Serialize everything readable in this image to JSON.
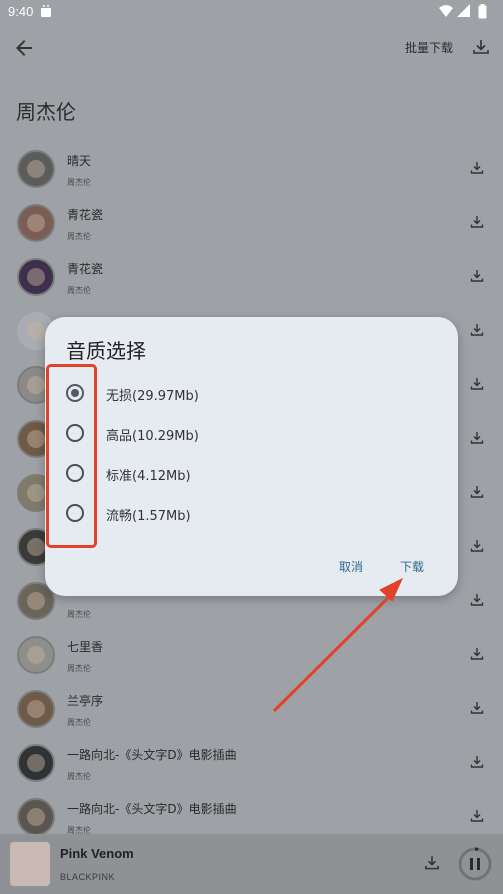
{
  "status_bar": {
    "time": "9:40"
  },
  "app_bar": {
    "batch_download_label": "批量下载"
  },
  "artist_title": "周杰伦",
  "songs": [
    {
      "title": "晴天",
      "artist": "周杰伦"
    },
    {
      "title": "青花瓷",
      "artist": "周杰伦"
    },
    {
      "title": "青花瓷",
      "artist": "周杰伦"
    },
    {
      "title": "",
      "artist": ""
    },
    {
      "title": "",
      "artist": ""
    },
    {
      "title": "",
      "artist": ""
    },
    {
      "title": "",
      "artist": ""
    },
    {
      "title": "",
      "artist": ""
    },
    {
      "title": "",
      "artist": "周杰伦"
    },
    {
      "title": "七里香",
      "artist": "周杰伦"
    },
    {
      "title": "兰亭序",
      "artist": "周杰伦"
    },
    {
      "title": "一路向北-《头文字D》电影插曲",
      "artist": "周杰伦"
    },
    {
      "title": "一路向北-《头文字D》电影插曲",
      "artist": "周杰伦"
    }
  ],
  "dialog": {
    "title": "音质选择",
    "options": [
      {
        "label": "无损(29.97Mb)",
        "selected": true
      },
      {
        "label": "高品(10.29Mb)",
        "selected": false
      },
      {
        "label": "标准(4.12Mb)",
        "selected": false
      },
      {
        "label": "流畅(1.57Mb)",
        "selected": false
      }
    ],
    "cancel_label": "取消",
    "confirm_label": "下载"
  },
  "player": {
    "title": "Pink Venom",
    "artist": "BLACKPINK"
  },
  "annotation_color": "#e2412a"
}
